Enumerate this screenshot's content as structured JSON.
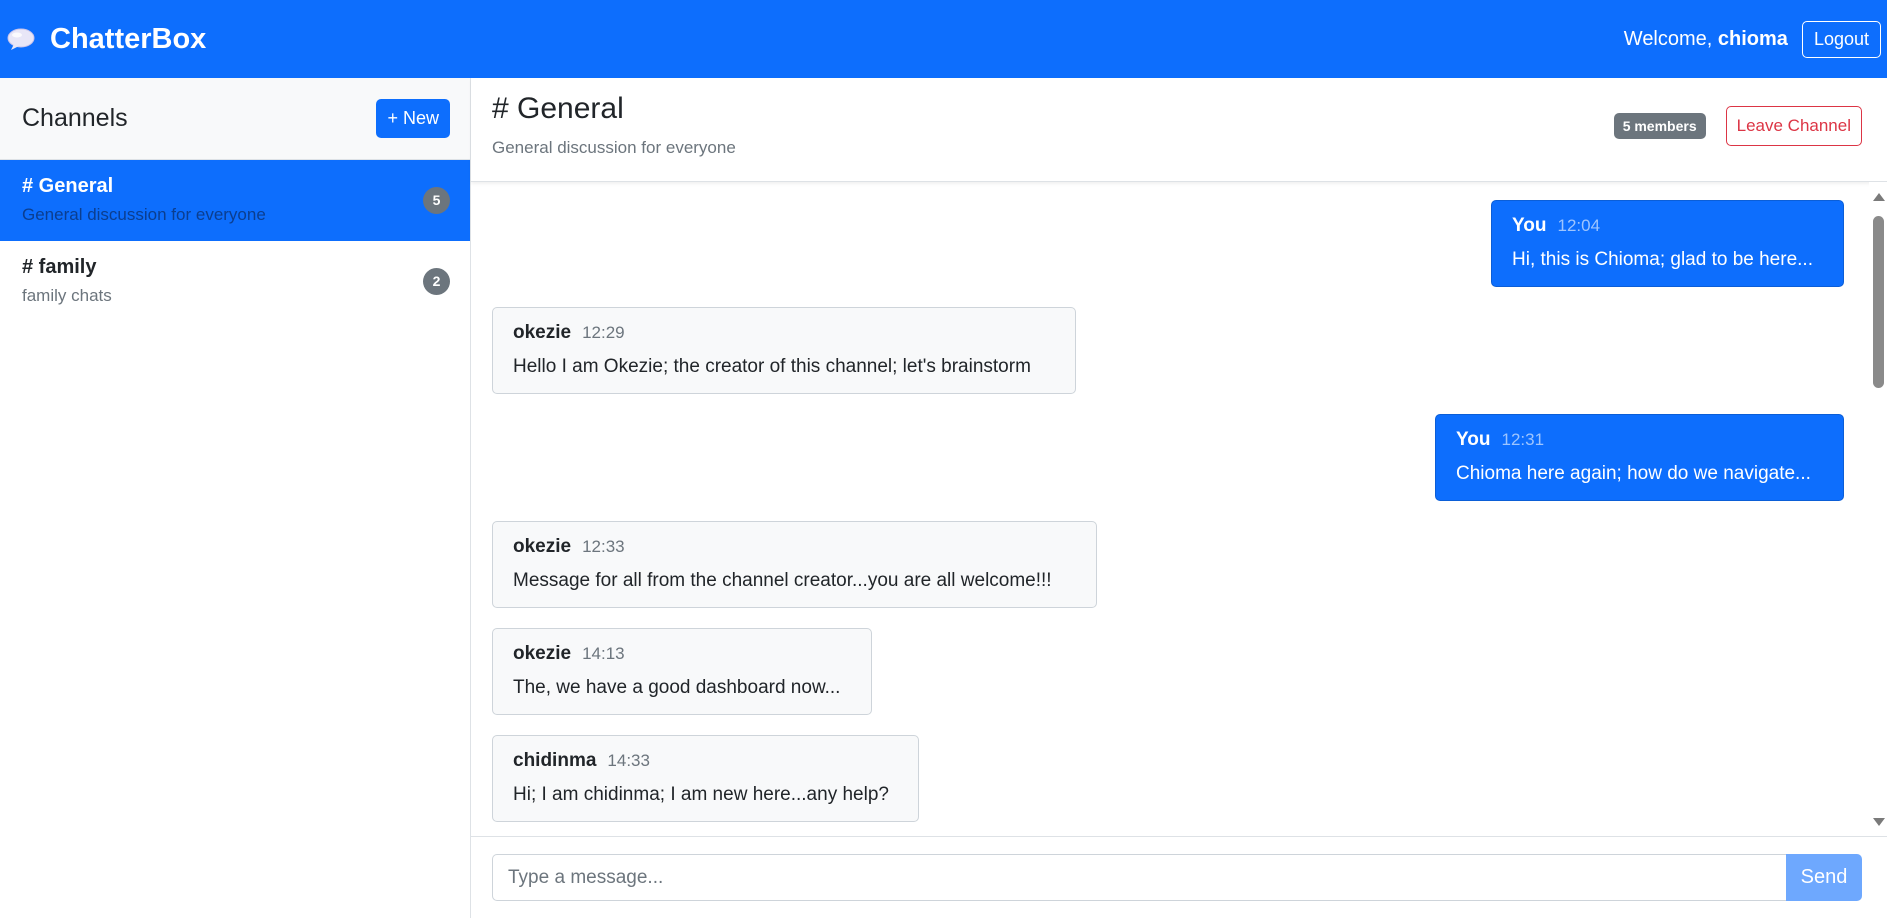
{
  "navbar": {
    "brand": "ChatterBox",
    "brand_icon": "speech-balloon-icon",
    "welcome_prefix": "Welcome,",
    "username": "chioma",
    "logout_label": "Logout"
  },
  "sidebar": {
    "title": "Channels",
    "new_label": "+ New",
    "channels": [
      {
        "name": "# General",
        "description": "General discussion for everyone",
        "count": "5",
        "active": true
      },
      {
        "name": "# family",
        "description": "family chats",
        "count": "2",
        "active": false
      }
    ]
  },
  "chat": {
    "title": "# General",
    "subtitle": "General discussion for everyone",
    "members_badge": "5 members",
    "leave_label": "Leave Channel",
    "messages": [
      {
        "author": "You",
        "time": "12:04",
        "text": "Hi, this is Chioma; glad to be here...",
        "mine": true
      },
      {
        "author": "okezie",
        "time": "12:29",
        "text": "Hello I am Okezie; the creator of this channel; let's brainstorm",
        "mine": false
      },
      {
        "author": "You",
        "time": "12:31",
        "text": "Chioma here again; how do we navigate...",
        "mine": true
      },
      {
        "author": "okezie",
        "time": "12:33",
        "text": "Message for all from the channel creator...you are all welcome!!!",
        "mine": false
      },
      {
        "author": "okezie",
        "time": "14:13",
        "text": "The, we have a good dashboard now...",
        "mine": false
      },
      {
        "author": "chidinma",
        "time": "14:33",
        "text": "Hi; I am chidinma; I am new here...any help?",
        "mine": false
      }
    ]
  },
  "composer": {
    "placeholder": "Type a message...",
    "send_label": "Send"
  },
  "colors": {
    "primary": "#0d6efd",
    "secondary": "#6c757d",
    "danger": "#dc3545",
    "send_disabled": "#6ea8fe"
  }
}
